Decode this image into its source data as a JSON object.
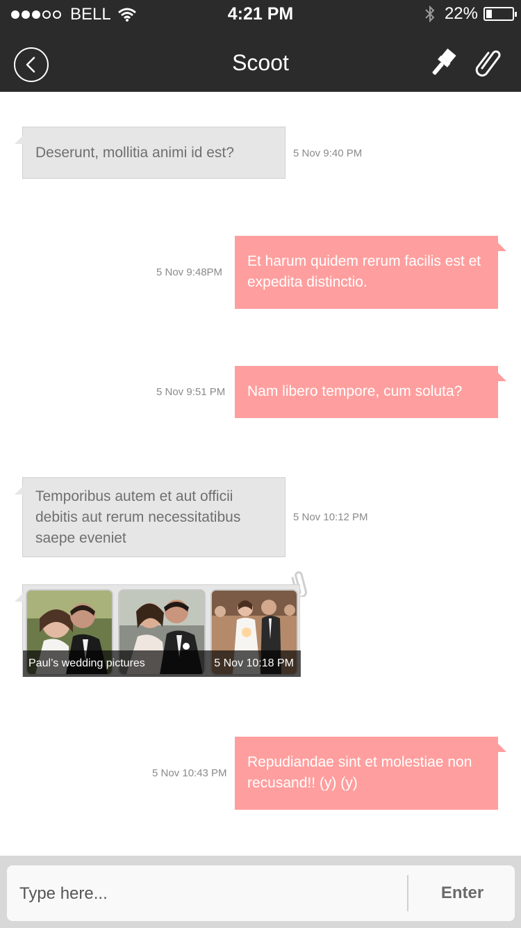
{
  "status_bar": {
    "carrier": "BELL",
    "time": "4:21 PM",
    "battery_text": "22%",
    "battery_level": 0.22,
    "signal_full": 3,
    "signal_total": 5
  },
  "nav": {
    "title": "Scoot",
    "back_icon": "back-circle-icon",
    "brush_icon": "paint-brush-icon",
    "attach_icon": "paperclip-icon"
  },
  "messages": [
    {
      "direction": "in",
      "text": "Deserunt, mollitia animi id est?",
      "time": "5 Nov 9:40 PM"
    },
    {
      "direction": "out",
      "text": "Et harum quidem rerum facilis est et expedita distinctio.",
      "time": "5 Nov 9:48PM"
    },
    {
      "direction": "out",
      "text": "Nam libero tempore, cum soluta?",
      "time": "5 Nov 9:51 PM"
    },
    {
      "direction": "in",
      "text": "Temporibus autem et aut officii debitis aut rerum necessitatibus saepe eveniet",
      "time": "5 Nov 10:12 PM"
    },
    {
      "direction": "out",
      "text": "Repudiandae sint et molestiae non recusand!! (y) (y)",
      "time": "5 Nov 10:43 PM"
    }
  ],
  "media": {
    "caption": "Paul’s wedding pictures",
    "time": "5 Nov 10:18 PM",
    "attach_icon": "paperclip-icon"
  },
  "composer": {
    "placeholder": "Type here...",
    "enter_label": "Enter"
  },
  "colors": {
    "bar": "#2b2b2b",
    "incoming": "#e6e6e6",
    "outgoing": "#ff9e9e",
    "timestamp": "#8a8a8a"
  }
}
